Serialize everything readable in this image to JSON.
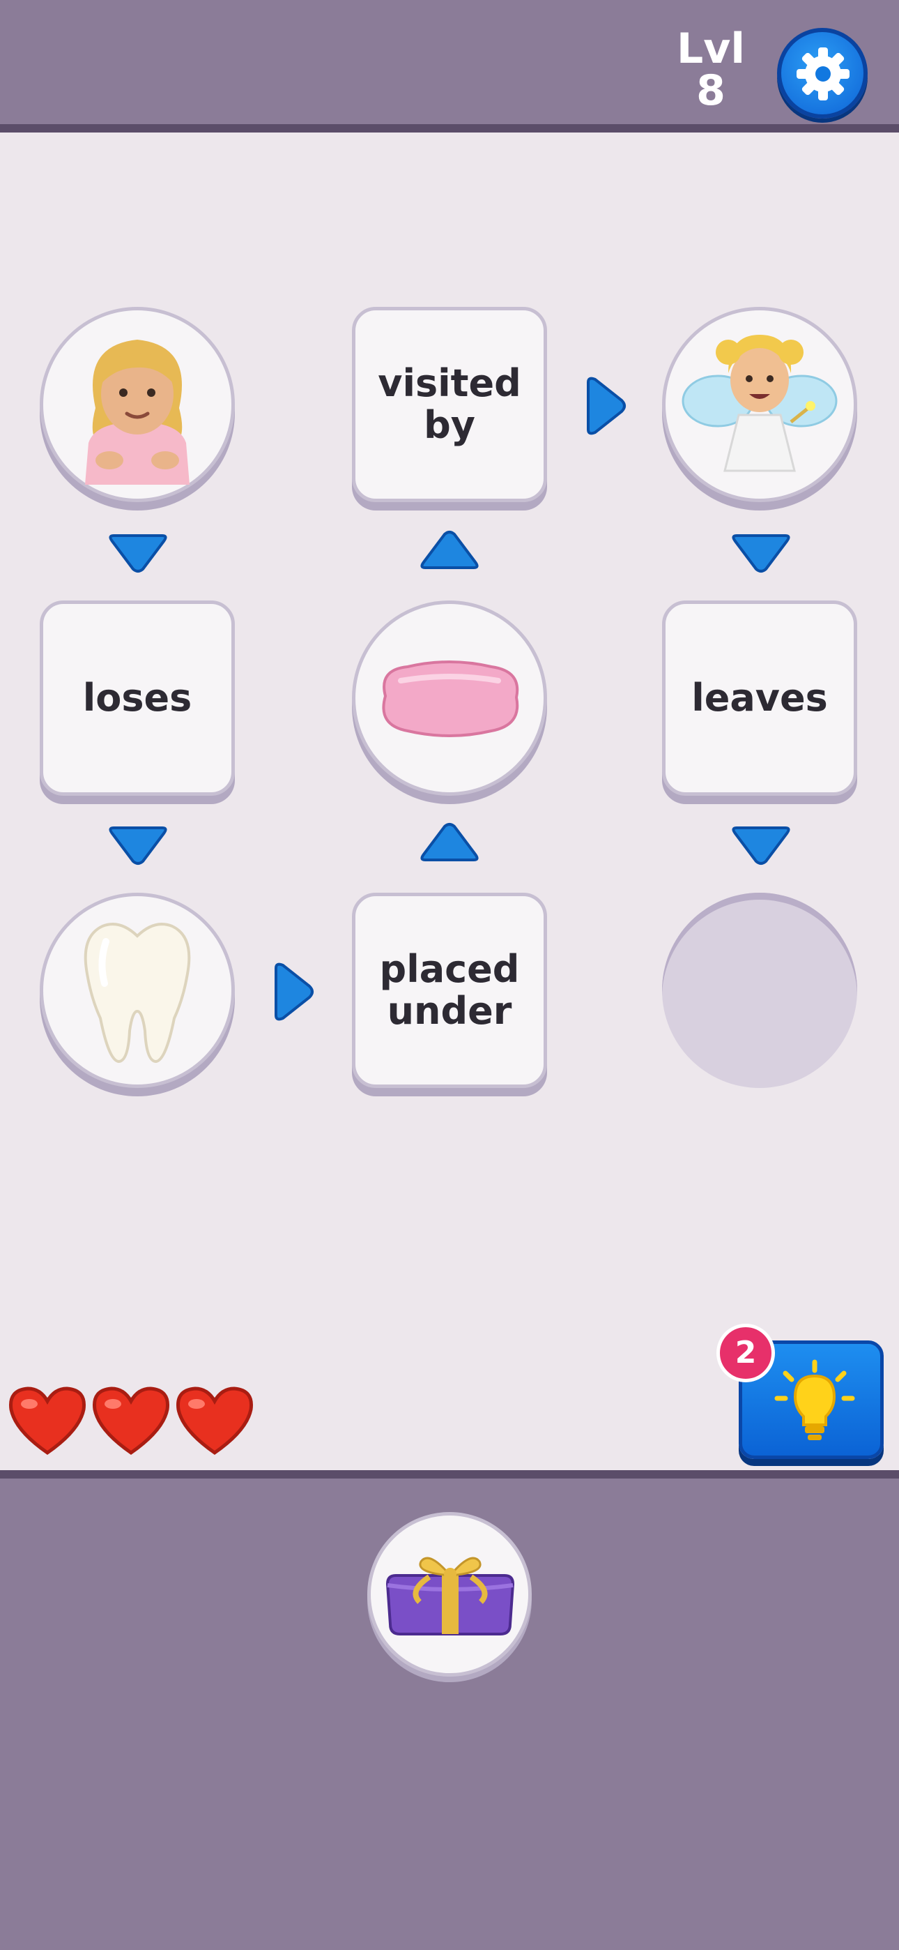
{
  "header": {
    "level_label": "Lvl",
    "level_number": "8"
  },
  "icons": {
    "settings": "gear-icon",
    "hint": "lightbulb-icon",
    "life": "heart-icon"
  },
  "nodes": {
    "girl": {
      "type": "image",
      "icon": "girl-emoji"
    },
    "visited_by": {
      "type": "word",
      "text": "visited\nby"
    },
    "fairy": {
      "type": "image",
      "icon": "fairy-emoji"
    },
    "loses": {
      "type": "word",
      "text": "loses"
    },
    "pillow": {
      "type": "image",
      "icon": "pillow-emoji"
    },
    "leaves": {
      "type": "word",
      "text": "leaves"
    },
    "tooth": {
      "type": "image",
      "icon": "tooth-emoji"
    },
    "placed_under": {
      "type": "word",
      "text": "placed\nunder"
    },
    "answer_slot": {
      "type": "empty"
    }
  },
  "hearts": {
    "remaining": 3,
    "icon": "heart-icon"
  },
  "hint": {
    "count": "2"
  },
  "tray": {
    "items": [
      {
        "icon": "gift-emoji"
      }
    ]
  },
  "colors": {
    "board_bg": "#ede7ec",
    "bar_bg": "#8b7c98",
    "arrow": "#1e86e0",
    "heart": "#e8301f",
    "badge": "#e7306a"
  }
}
